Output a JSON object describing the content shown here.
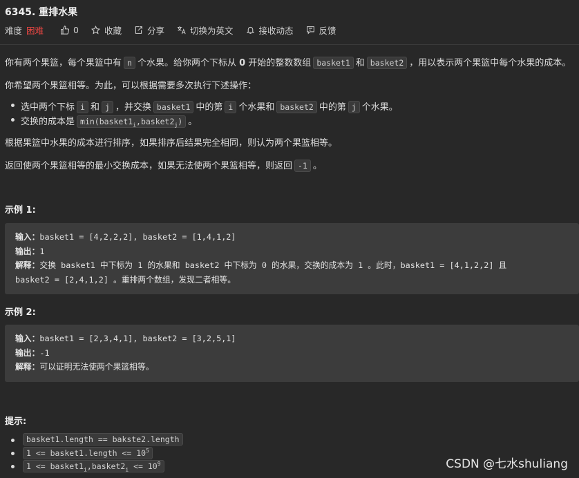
{
  "problem": {
    "title": "6345. 重排水果",
    "difficulty_label": "难度",
    "difficulty": "困难",
    "like_count": "0",
    "actions": {
      "favorite": "收藏",
      "share": "分享",
      "translate": "切换为英文",
      "subscribe": "接收动态",
      "feedback": "反馈"
    }
  },
  "desc": {
    "p1": {
      "a": "你有两个果篮，每个果篮中有",
      "c1": "n",
      "b": "个水果。给你两个下标从",
      "zero": "0",
      "c": "开始的整数数组",
      "c2": "basket1",
      "d": "和",
      "c3": "basket2",
      "e": "，用以表示两个果篮中每个水果的成本。"
    },
    "p2": "你希望两个果篮相等。为此，可以根据需要多次执行下述操作：",
    "b1": {
      "a": "选中两个下标",
      "c1": "i",
      "b": "和",
      "c2": "j",
      "c": "，并交换",
      "c3": "basket1",
      "d": "中的第",
      "c4": "i",
      "e": "个水果和",
      "c5": "basket2",
      "f": "中的第",
      "c6": "j",
      "g": "个水果。"
    },
    "b2": {
      "a": "交换的成本是",
      "c1": "min(basket1",
      "c1sub": "i",
      "c1mid": ",basket2",
      "c1sub2": "j",
      "c1end": ")",
      "b": "。"
    },
    "p3": "根据果篮中水果的成本进行排序，如果排序后结果完全相同，则认为两个果篮相等。",
    "p4": {
      "a": "返回使两个果篮相等的最小交换成本，如果无法使两个果篮相等，则返回",
      "c1": "-1",
      "b": "。"
    }
  },
  "example1": {
    "heading": "示例 1:",
    "input_label": "输入：",
    "input": "basket1 = [4,2,2,2], basket2 = [1,4,1,2]",
    "output_label": "输出：",
    "output": "1",
    "explain_label": "解释：",
    "explain1": "交换 basket1 中下标为 1 的水果和 basket2 中下标为 0 的水果，交换的成本为 1 。此时，basket1 = [4,1,2,2] 且",
    "explain2": "basket2 = [2,4,1,2] 。重排两个数组，发现二者相等。"
  },
  "example2": {
    "heading": "示例 2:",
    "input_label": "输入：",
    "input": "basket1 = [2,3,4,1], basket2 = [3,2,5,1]",
    "output_label": "输出：",
    "output": "-1",
    "explain_label": "解释：",
    "explain": "可以证明无法使两个果篮相等。"
  },
  "hints": {
    "heading": "提示:",
    "h1": "basket1.length == bakste2.length",
    "h2": "1 <= basket1.length <= 10",
    "h2sup": "5",
    "h3a": "1 <= basket1",
    "h3sub1": "i",
    "h3mid": ",basket2",
    "h3sub2": "i",
    "h3b": " <= 10",
    "h3sup": "9"
  },
  "watermark": "CSDN @七水shuliang"
}
